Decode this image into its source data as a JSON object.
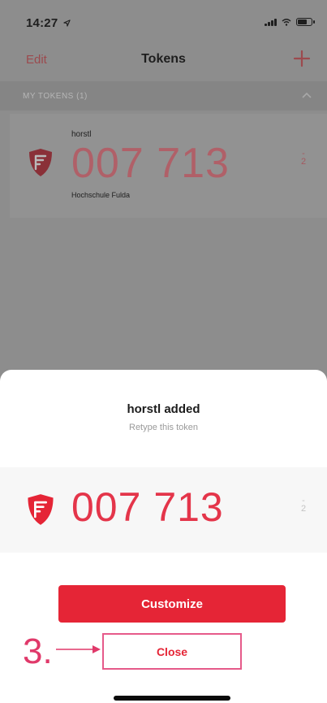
{
  "status_bar": {
    "time": "14:27",
    "location_icon": "location-arrow-icon",
    "signal_icon": "cellular-signal-icon",
    "wifi_icon": "wifi-icon",
    "battery_icon": "battery-icon",
    "battery_level": 0.7
  },
  "nav": {
    "edit_label": "Edit",
    "title": "Tokens",
    "add_icon": "plus-icon"
  },
  "section": {
    "label": "MY TOKENS (1)",
    "chevron_icon": "chevron-up-icon"
  },
  "token_list": [
    {
      "name": "horstl",
      "code": "007 713",
      "issuer": "Hochschule Fulda",
      "timer": "2",
      "logo_icon": "token-shield-icon"
    }
  ],
  "sheet": {
    "title": "horstl added",
    "subtitle": "Retype this token",
    "token": {
      "code": "007 713",
      "timer": "2",
      "logo_icon": "token-shield-icon"
    },
    "customize_label": "Customize",
    "close_label": "Close"
  },
  "annotation": {
    "step": "3.",
    "arrow_icon": "arrow-right-icon"
  },
  "colors": {
    "accent": "#e52536",
    "annotation": "#e0396a",
    "overlay": "#8d8d8d"
  }
}
